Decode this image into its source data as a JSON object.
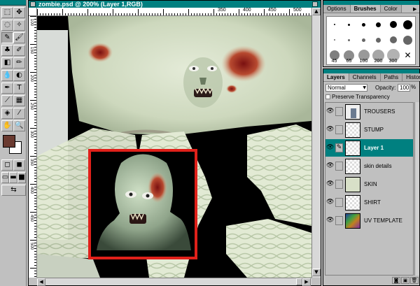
{
  "document": {
    "title": "zombie.psd @ 200% (Layer 1,RGB)",
    "ruler_h": [
      "350",
      "400",
      "450",
      "500"
    ],
    "ruler_v": [
      "100",
      "150",
      "200",
      "250",
      "300",
      "350",
      "400",
      "450",
      "500"
    ]
  },
  "toolbox": {
    "tools": [
      {
        "icon": "marquee-icon",
        "glyph": "⬚"
      },
      {
        "icon": "move-icon",
        "glyph": "✥"
      },
      {
        "icon": "lasso-icon",
        "glyph": "◌"
      },
      {
        "icon": "magic-wand-icon",
        "glyph": "✧"
      },
      {
        "icon": "airbrush-icon",
        "glyph": "✎"
      },
      {
        "icon": "paintbrush-icon",
        "glyph": "🖌"
      },
      {
        "icon": "rubber-stamp-icon",
        "glyph": "♣"
      },
      {
        "icon": "history-brush-icon",
        "glyph": "✐"
      },
      {
        "icon": "eraser-icon",
        "glyph": "◧"
      },
      {
        "icon": "pencil-icon",
        "glyph": "✏"
      },
      {
        "icon": "blur-icon",
        "glyph": "💧"
      },
      {
        "icon": "dodge-icon",
        "glyph": "◐"
      },
      {
        "icon": "pen-icon",
        "glyph": "✒"
      },
      {
        "icon": "type-icon",
        "glyph": "T"
      },
      {
        "icon": "measure-icon",
        "glyph": "⟋"
      },
      {
        "icon": "gradient-icon",
        "glyph": "▦"
      },
      {
        "icon": "paint-bucket-icon",
        "glyph": "◈"
      },
      {
        "icon": "eyedropper-icon",
        "glyph": "⁄"
      },
      {
        "icon": "hand-icon",
        "glyph": "✋"
      },
      {
        "icon": "zoom-icon",
        "glyph": "🔍"
      }
    ],
    "foreground_color": "#6a3a30",
    "background_color": "#ffffff"
  },
  "brushes_palette": {
    "tabs": [
      "Options",
      "Brushes",
      "Color"
    ],
    "active_tab": "Brushes",
    "brush_labels": [
      "45",
      "65",
      "100",
      "200",
      "300"
    ]
  },
  "layers_palette": {
    "tabs": [
      "Layers",
      "Channels",
      "Paths",
      "History"
    ],
    "blend_mode": "Normal",
    "opacity_label": "Opacity:",
    "opacity_value": "100",
    "preserve_transparency": "Preserve Transparency",
    "layers": [
      {
        "name": "TROUSERS",
        "selected": false
      },
      {
        "name": "STUMP",
        "selected": false
      },
      {
        "name": "Layer 1",
        "selected": true
      },
      {
        "name": "skin details",
        "selected": false
      },
      {
        "name": "SKIN",
        "selected": false
      },
      {
        "name": "SHIRT",
        "selected": false
      },
      {
        "name": "UV TEMPLATE",
        "selected": false
      }
    ]
  },
  "colors": {
    "titlebar": "#008080",
    "highlight": "#ff2020",
    "skin": "#c8d4b8"
  }
}
